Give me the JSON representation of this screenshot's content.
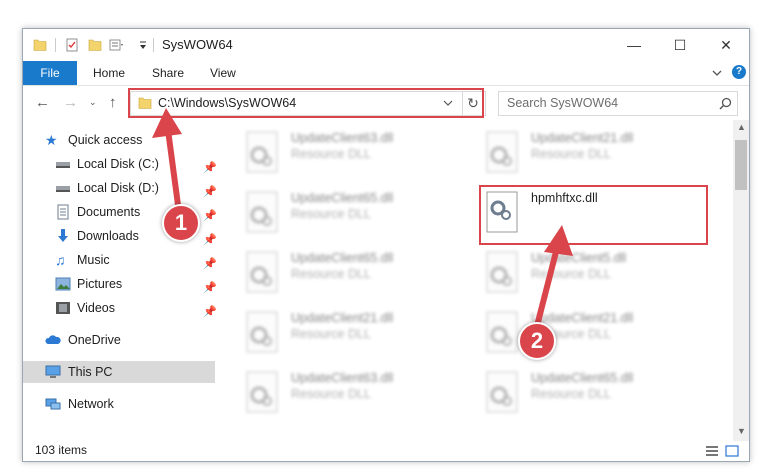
{
  "window": {
    "title": "SysWOW64",
    "controls": {
      "minimize": "—",
      "maximize": "☐",
      "close": "✕"
    }
  },
  "ribbon": {
    "tabs": [
      "File",
      "Home",
      "Share",
      "View"
    ],
    "expand_icon": "chevron-down-icon",
    "help_icon": "?"
  },
  "navigation": {
    "address": "C:\\Windows\\SysWOW64",
    "search_placeholder": "Search SysWOW64"
  },
  "sidebar": {
    "items": [
      {
        "label": "Quick access",
        "icon": "star-icon"
      },
      {
        "label": "Local Disk (C:)",
        "icon": "drive-icon"
      },
      {
        "label": "Local Disk (D:)",
        "icon": "drive-icon"
      },
      {
        "label": "Documents",
        "icon": "documents-icon"
      },
      {
        "label": "Downloads",
        "icon": "download-icon"
      },
      {
        "label": "Music",
        "icon": "music-icon"
      },
      {
        "label": "Pictures",
        "icon": "pictures-icon"
      },
      {
        "label": "Videos",
        "icon": "videos-icon"
      },
      {
        "label": "OneDrive",
        "icon": "cloud-icon"
      },
      {
        "label": "This PC",
        "icon": "computer-icon"
      },
      {
        "label": "Network",
        "icon": "network-icon"
      }
    ]
  },
  "files": [
    {
      "name": "UpdateClient63.dll",
      "type": "Resource DLL"
    },
    {
      "name": "UpdateClient21.dll",
      "type": "Resource DLL"
    },
    {
      "name": "UpdateClient65.dll",
      "type": "Resource DLL"
    },
    {
      "name": "hpmhftxc.dll",
      "type": ""
    },
    {
      "name": "UpdateClient65.dll",
      "type": "Resource DLL"
    },
    {
      "name": "UpdateClient5.dll",
      "type": "Resource DLL"
    },
    {
      "name": "UpdateClient21.dll",
      "type": "Resource DLL"
    },
    {
      "name": "UpdateClient21.dll",
      "type": "Resource DLL"
    },
    {
      "name": "UpdateClient63.dll",
      "type": "Resource DLL"
    },
    {
      "name": "UpdateClient65.dll",
      "type": "Resource DLL"
    }
  ],
  "status": {
    "item_count": "103 items"
  },
  "annotations": {
    "step1": "1",
    "step2": "2",
    "color": "#d9454b"
  }
}
